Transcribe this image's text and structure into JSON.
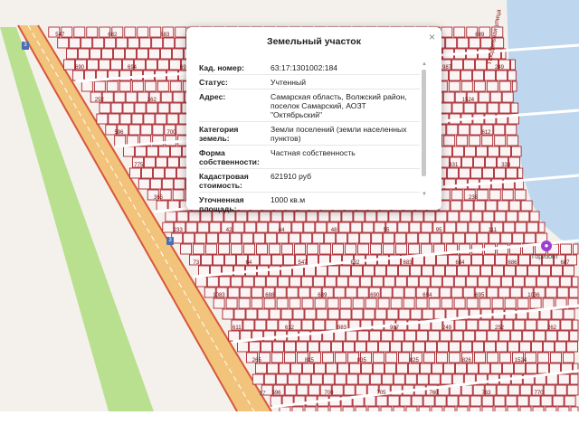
{
  "popup": {
    "title": "Земельный участок",
    "close_icon": "×",
    "rows": [
      {
        "label": "Кад. номер:",
        "value": "63:17:1301002:184"
      },
      {
        "label": "Статус:",
        "value": "Учтенный"
      },
      {
        "label": "Адрес:",
        "value": "Самарская область, Волжский район, поселок Самарский, АОЗТ \"Октябрьский\""
      },
      {
        "label": "Категория земель:",
        "value": "Земли поселений (земли населенных пунктов)"
      },
      {
        "label": "Форма собственности:",
        "value": "Частная собственность"
      },
      {
        "label": "Кадастровая стоимость:",
        "value": "621910 руб"
      },
      {
        "label": "Уточненная площадь:",
        "value": "1000 кв.м"
      }
    ]
  },
  "map": {
    "route_badges": [
      "3",
      "3"
    ],
    "road_labels": [
      "17",
      "17"
    ],
    "street_label": "Продольная улица",
    "poi_label": "Горизонт",
    "parcel_numbers": [
      "547",
      "682",
      "683",
      "684",
      "686",
      "687",
      "1083",
      "688",
      "689",
      "690",
      "694",
      "695",
      "1036",
      "611",
      "612",
      "983",
      "987",
      "249",
      "252",
      "262",
      "265",
      "815",
      "835",
      "825",
      "826",
      "1524",
      "596",
      "700",
      "705",
      "760",
      "763",
      "770",
      "807",
      "612",
      "775",
      "771",
      "246",
      "195",
      "172",
      "178",
      "331",
      "333",
      "365",
      "367",
      "378",
      "393",
      "214",
      "275",
      "238",
      "233",
      "42",
      "44",
      "48",
      "55",
      "95",
      "111",
      "73",
      "64"
    ]
  },
  "colors": {
    "parcel_border": "#a0101a",
    "parcel_fill": "#fbf4f4",
    "water": "#bfd7ee",
    "green_strip": "#b9e08f",
    "highway": "#f2c37a",
    "highway_edge": "#d8563c",
    "ground": "#f4f1ec"
  }
}
